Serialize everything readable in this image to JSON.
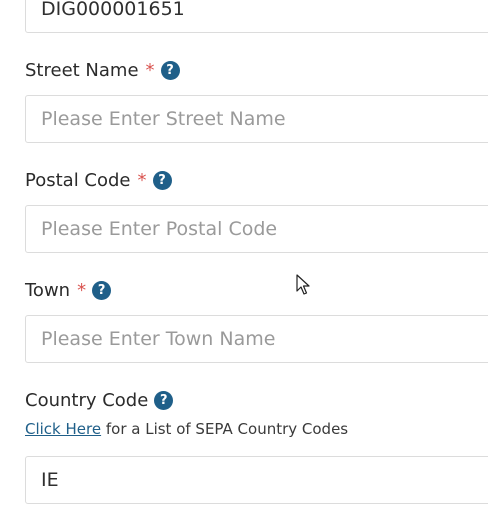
{
  "top_field": {
    "value": "DIG000001651"
  },
  "street": {
    "label": "Street Name",
    "required_mark": "*",
    "help_glyph": "?",
    "placeholder": "Please Enter Street Name"
  },
  "postal": {
    "label": "Postal Code",
    "required_mark": "*",
    "help_glyph": "?",
    "placeholder": "Please Enter Postal Code"
  },
  "town": {
    "label": "Town",
    "required_mark": "*",
    "help_glyph": "?",
    "placeholder": "Please Enter Town Name"
  },
  "country": {
    "label": "Country Code",
    "help_glyph": "?",
    "link_text": "Click Here",
    "hint_text": " for a List of SEPA Country Codes",
    "value": "IE"
  },
  "colors": {
    "required": "#d9534f",
    "help_icon": "#1f5f89",
    "link": "#1f5f89"
  },
  "icons": {
    "help": "question-circle-icon",
    "pointer": "mouse-cursor-icon"
  }
}
